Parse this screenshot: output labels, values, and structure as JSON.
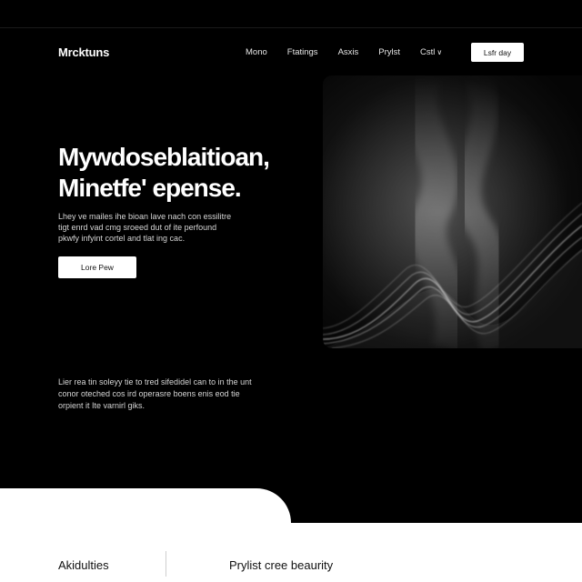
{
  "header": {
    "brand": "Mrcktuns",
    "nav": [
      {
        "label": "Mono"
      },
      {
        "label": "Ftatings"
      },
      {
        "label": "Asxis"
      },
      {
        "label": "Prylst"
      },
      {
        "label": "Cstl"
      }
    ],
    "nav_dropdown_caret": "∨",
    "cta_label": "Lsfr day"
  },
  "hero": {
    "title_line1": "Mywdoseblaitioan,",
    "title_line2": "Minetfe' epense.",
    "subtitle_lines": [
      "Lhey ve mailes ihe bioan lave nach con essilitre",
      "tigt enrd vad cmg sroeed dut of ite perfound",
      "pkwfy infyint cortel and tlat ing cac."
    ],
    "button_label": "Lore Pew"
  },
  "visual": {
    "icon": "smoke-wave-image"
  },
  "body": {
    "lines": [
      "Lier rea tin soleyy tie to tred sifedidel can to in the unt",
      "conor oteched cos ird operasre boens enis eod tie",
      "orpient it Ite varnirl giks."
    ]
  },
  "footer": {
    "left_label": "Akidulties",
    "right_label": "Prylist cree beaurity"
  },
  "colors": {
    "background": "#000000",
    "text": "#ffffff",
    "button_bg": "#ffffff",
    "button_text": "#111111",
    "footer_bg": "#ffffff"
  }
}
